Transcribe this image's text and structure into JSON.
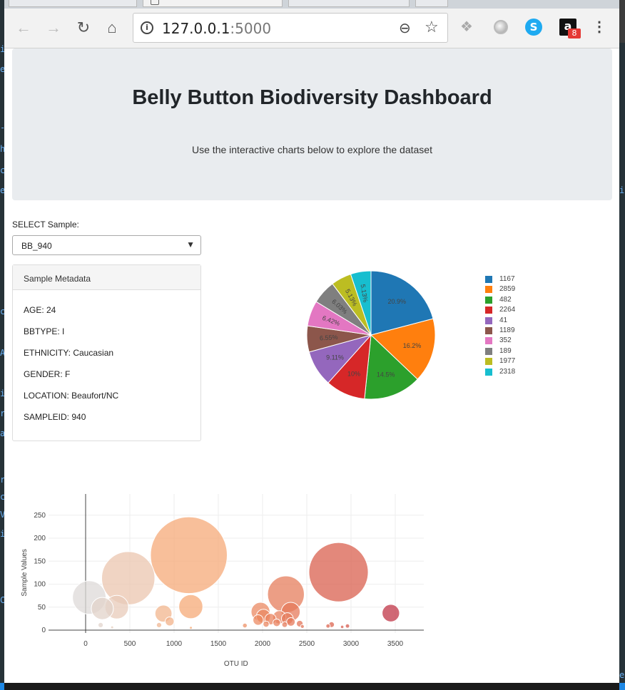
{
  "editor_strips": {
    "left_glyphs": [
      "i",
      "e",
      "-",
      "h",
      "c",
      "e",
      "c",
      "A",
      "i",
      "r",
      "a",
      "r",
      "c",
      "V",
      "i",
      "C"
    ],
    "right_glyphs": [
      "i",
      "e"
    ]
  },
  "browser": {
    "url_host": "127.0.0.1",
    "url_port": ":5000",
    "nav": {
      "back_icon": "←",
      "forward_icon": "→",
      "reload_icon": "↻",
      "home_icon": "⌂"
    },
    "amazon_badge": "8",
    "skype_letter": "S",
    "amazon_letter": "a",
    "zoom_icon": "⊖",
    "star_icon": "☆",
    "menu_icon": "⋮",
    "dropbox_icon": "❖",
    "info_icon": "i"
  },
  "header": {
    "title": "Belly Button Biodiversity Dashboard",
    "subtitle": "Use the interactive charts below to explore the dataset"
  },
  "selector": {
    "label": "SELECT Sample:",
    "value": "BB_940",
    "arrow": "▼"
  },
  "metadata": {
    "title": "Sample Metadata",
    "lines": [
      "AGE: 24",
      "BBTYPE: I",
      "ETHNICITY: Caucasian",
      "GENDER: F",
      "LOCATION: Beaufort/NC",
      "SAMPLEID: 940"
    ]
  },
  "chart_data": [
    {
      "type": "pie",
      "labels": [
        "1167",
        "2859",
        "482",
        "2264",
        "41",
        "1189",
        "352",
        "189",
        "1977",
        "2318"
      ],
      "percents": [
        20.9,
        16.2,
        14.5,
        10,
        9.11,
        6.55,
        6.42,
        6.03,
        5.13,
        5.13
      ],
      "percent_labels": [
        "20.9%",
        "16.2%",
        "14.5%",
        "10%",
        "9.11%",
        "6.55%",
        "6.42%",
        "6.03%",
        "5.13%",
        "5.13%"
      ],
      "colors": [
        "#1f77b4",
        "#ff7f0e",
        "#2ca02c",
        "#d62728",
        "#9467bd",
        "#8c564b",
        "#e377c2",
        "#7f7f7f",
        "#bcbd22",
        "#17becf"
      ],
      "legend_placement": "right"
    },
    {
      "type": "scatter",
      "xlabel": "OTU ID",
      "ylabel": "Sample Values",
      "xlim": [
        -100,
        3800
      ],
      "ylim": [
        -10,
        300
      ],
      "xticks": [
        0,
        500,
        1000,
        1500,
        2000,
        2500,
        3000,
        3500
      ],
      "yticks": [
        0,
        50,
        100,
        150,
        200,
        250
      ],
      "grid": true,
      "points": [
        {
          "x": 1167,
          "y": 163
        },
        {
          "x": 2859,
          "y": 126
        },
        {
          "x": 482,
          "y": 113
        },
        {
          "x": 2264,
          "y": 78
        },
        {
          "x": 41,
          "y": 71
        },
        {
          "x": 1189,
          "y": 51
        },
        {
          "x": 352,
          "y": 50
        },
        {
          "x": 189,
          "y": 47
        },
        {
          "x": 1977,
          "y": 40
        },
        {
          "x": 2318,
          "y": 40
        },
        {
          "x": 3450,
          "y": 37
        },
        {
          "x": 880,
          "y": 36
        },
        {
          "x": 2010,
          "y": 30
        },
        {
          "x": 2190,
          "y": 28
        },
        {
          "x": 2280,
          "y": 25
        },
        {
          "x": 2090,
          "y": 24
        },
        {
          "x": 1950,
          "y": 22
        },
        {
          "x": 950,
          "y": 19
        },
        {
          "x": 2320,
          "y": 18
        },
        {
          "x": 2160,
          "y": 16
        },
        {
          "x": 2420,
          "y": 14
        },
        {
          "x": 2040,
          "y": 13
        },
        {
          "x": 2250,
          "y": 12
        },
        {
          "x": 2780,
          "y": 12
        },
        {
          "x": 170,
          "y": 11
        },
        {
          "x": 830,
          "y": 11
        },
        {
          "x": 1800,
          "y": 10
        },
        {
          "x": 2960,
          "y": 9
        },
        {
          "x": 2740,
          "y": 9
        },
        {
          "x": 2450,
          "y": 8
        },
        {
          "x": 2900,
          "y": 7
        },
        {
          "x": 300,
          "y": 6
        },
        {
          "x": 1190,
          "y": 5
        }
      ],
      "bubble_scale": "marker size equals sample value",
      "colorscale": "Earth"
    }
  ]
}
